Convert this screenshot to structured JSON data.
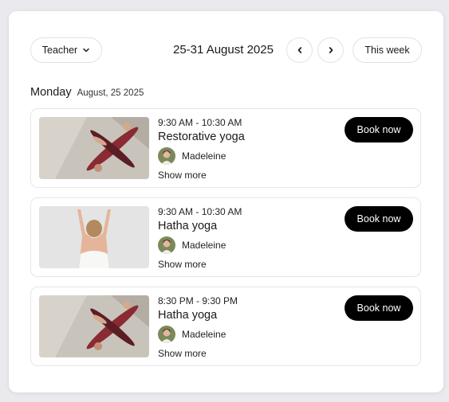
{
  "filter": {
    "teacher_label": "Teacher",
    "icon": "chevron-down-icon"
  },
  "week": {
    "range": "25-31 August 2025",
    "prev_icon": "chevron-left-icon",
    "next_icon": "chevron-right-icon",
    "this_week_label": "This week"
  },
  "day": {
    "name": "Monday",
    "date": "August, 25 2025"
  },
  "classes": [
    {
      "time": "9:30 AM - 10:30 AM",
      "name": "Restorative yoga",
      "teacher": "Madeleine",
      "show_more": "Show more",
      "book_label": "Book now"
    },
    {
      "time": "9:30 AM - 10:30 AM",
      "name": "Hatha yoga",
      "teacher": "Madeleine",
      "show_more": "Show more",
      "book_label": "Book now"
    },
    {
      "time": "8:30 PM - 9:30 PM",
      "name": "Hatha yoga",
      "teacher": "Madeleine",
      "show_more": "Show more",
      "book_label": "Book now"
    }
  ],
  "colors": {
    "accent": "#000000",
    "background": "#e9e9ee",
    "card": "#ffffff"
  }
}
